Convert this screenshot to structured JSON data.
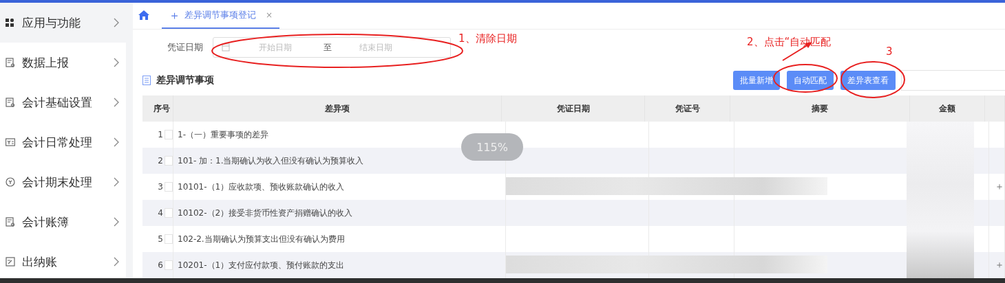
{
  "sidebar": {
    "items": [
      {
        "label": "应用与功能",
        "kind": "grid",
        "selected": true
      },
      {
        "label": "数据上报",
        "kind": "doc",
        "selected": false
      },
      {
        "label": "会计基础设置",
        "kind": "doc",
        "selected": false
      },
      {
        "label": "会计日常处理",
        "kind": "card",
        "selected": false
      },
      {
        "label": "会计期末处理",
        "kind": "clock",
        "selected": false
      },
      {
        "label": "会计账簿",
        "kind": "doc",
        "selected": false
      },
      {
        "label": "出纳账",
        "kind": "edit",
        "selected": false
      }
    ]
  },
  "tabs": [
    {
      "icon": "＋",
      "label": "差异调节事项登记",
      "close": "×",
      "selected": true
    }
  ],
  "filter": {
    "label": "凭证日期",
    "start_placeholder": "开始日期",
    "separator": "至",
    "end_placeholder": "结束日期"
  },
  "section_title": "差异调节事项",
  "buttons": [
    "批量新增",
    "自动匹配",
    "差异表查看"
  ],
  "table": {
    "columns": [
      "序号",
      "差异项",
      "凭证日期",
      "凭证号",
      "摘要",
      "金额"
    ],
    "amount_blurred": true,
    "rows": [
      {
        "index": "1",
        "item": "1-（一）重要事项的差异",
        "blurred": false,
        "checked": false
      },
      {
        "index": "2",
        "item": "101- 加：1.当期确认为收入但没有确认为预算收入",
        "blurred": false,
        "checked": false
      },
      {
        "index": "3",
        "item": "10101-（1）应收款项、预收账款确认的收入",
        "blurred": true,
        "action": "＋",
        "checked": false
      },
      {
        "index": "4",
        "item": "10102-（2）接受非货币性资产捐赠确认的收入",
        "blurred": false,
        "checked": false
      },
      {
        "index": "5",
        "item": "102-2.当期确认为预算支出但没有确认为费用",
        "blurred": false,
        "checked": false
      },
      {
        "index": "6",
        "item": "10201-（1）支付应付款项、预付账款的支出",
        "blurred": true,
        "action": "＋",
        "checked": false
      }
    ]
  },
  "zoom_badge": "115%",
  "annotations": [
    {
      "text": "1、清除日期"
    },
    {
      "text": "2、点击“自动匹配"
    },
    {
      "text": "3"
    }
  ]
}
